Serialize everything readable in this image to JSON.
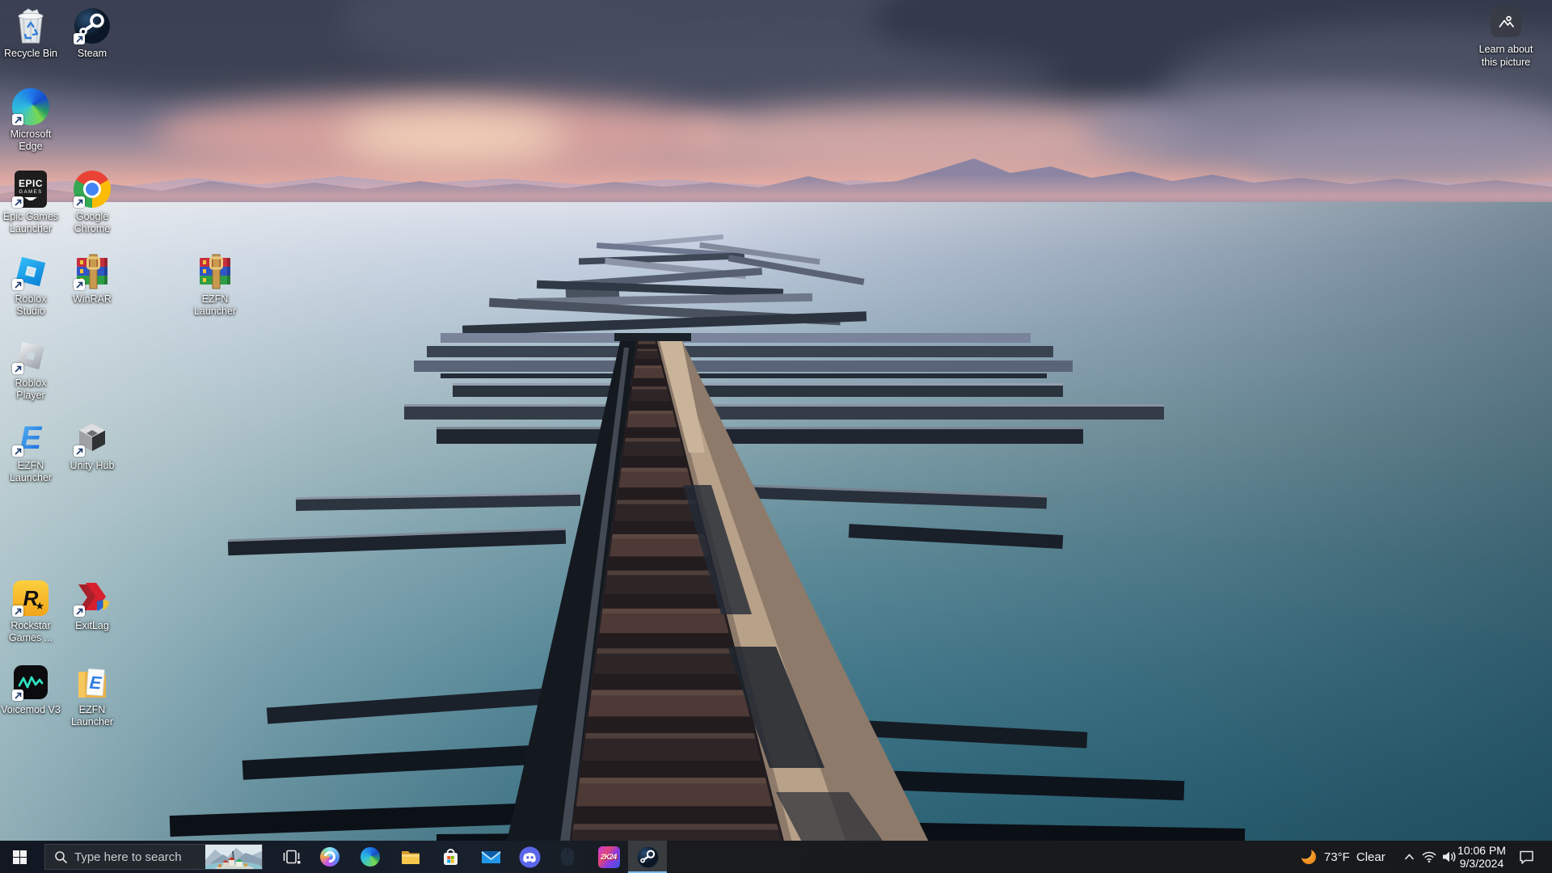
{
  "desktop": {
    "icons": [
      {
        "label1": "Recycle Bin"
      },
      {
        "label1": "Steam"
      },
      {
        "label1": "Microsoft",
        "label2": "Edge"
      },
      {
        "label1": "Epic Games",
        "label2": "Launcher",
        "logo1": "EPIC",
        "logo2": "GAMES"
      },
      {
        "label1": "Google",
        "label2": "Chrome"
      },
      {
        "label1": "Roblox",
        "label2": "Studio"
      },
      {
        "label1": "WinRAR"
      },
      {
        "label1": "EZFN",
        "label2": "Launcher"
      },
      {
        "label1": "Roblox Player"
      },
      {
        "label1": "EZFN",
        "label2": "Launcher",
        "logo1": "E"
      },
      {
        "label1": "Unity Hub"
      },
      {
        "label1": "Rockstar",
        "label2": "Games ...",
        "logo1": "R",
        "logo2": "★"
      },
      {
        "label1": "ExitLag"
      },
      {
        "label1": "Voicemod V3"
      },
      {
        "label1": "EZFN",
        "label2": "Launcher",
        "logo1": "E"
      }
    ],
    "learn_about": {
      "label1": "Learn about",
      "label2": "this picture"
    }
  },
  "taskbar": {
    "search": {
      "placeholder": "Type here to search"
    },
    "apps": {
      "nba2k_badge": "2K24"
    },
    "tray": {
      "temperature": "73°F",
      "condition": "Clear",
      "time": "10:06 PM",
      "date": "9/3/2024"
    }
  },
  "colors": {
    "accent": "#76b9ed",
    "taskbar": "#17191c",
    "sea": "#2a6173"
  }
}
